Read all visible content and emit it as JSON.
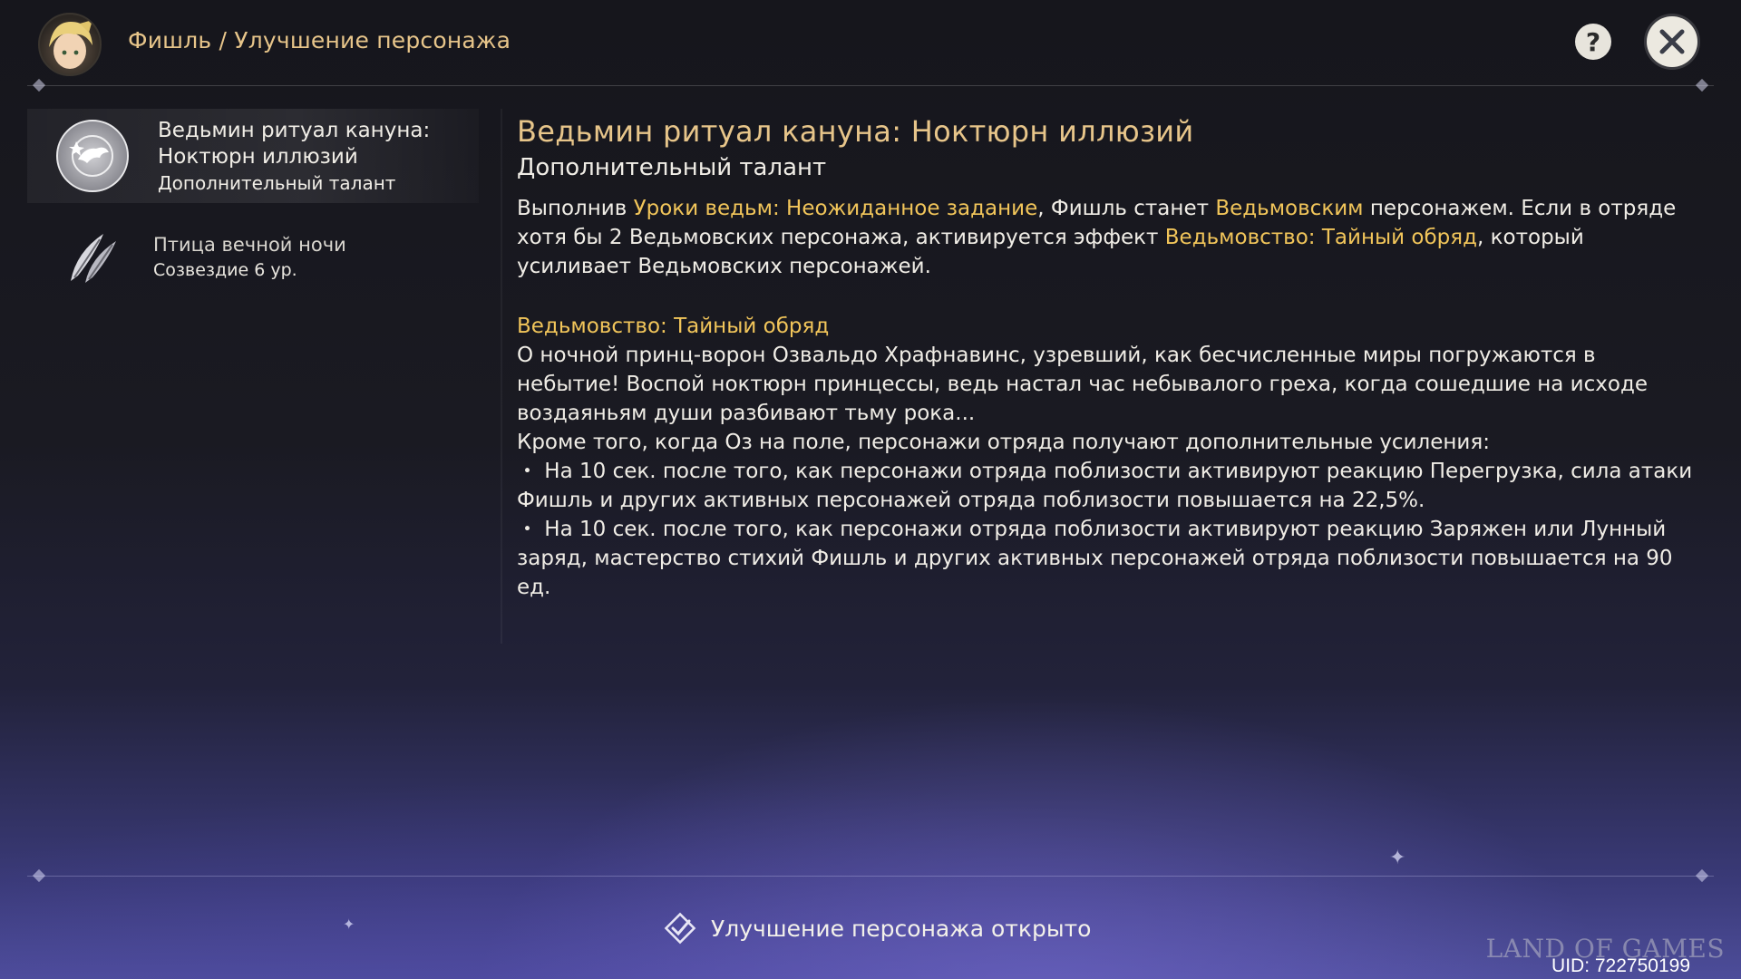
{
  "header": {
    "breadcrumb": "Фишль / Улучшение персонажа"
  },
  "sidebar": {
    "items": [
      {
        "title_line1": "Ведьмин ритуал кануна:",
        "title_line2": "Ноктюрн иллюзий",
        "subtitle": "Дополнительный талант",
        "icon": "crow-emblem-icon",
        "selected": true
      },
      {
        "title_line1": "Птица вечной ночи",
        "subtitle": "Созвездие 6 ур.",
        "icon": "feathers-icon",
        "selected": false
      }
    ]
  },
  "detail": {
    "title": "Ведьмин ритуал кануна: Ноктюрн иллюзий",
    "subtitle": "Дополнительный талант",
    "p1": {
      "t1": "Выполнив ",
      "h1": "Уроки ведьм: Неожиданное задание",
      "t2": ", Фишль станет ",
      "h2": "Ведьмовским",
      "t3": " персонажем. Если в отряде хотя бы 2 Ведьмовских персонажа, активируется эффект ",
      "h3": "Ведьмовство: Тайный обряд",
      "t4": ", который усиливает Ведьмовских персонажей."
    },
    "section_title": "Ведьмовство: Тайный обряд",
    "lore": "О ночной принц-ворон Озвальдо Храфнавинс, узревший, как бесчисленные миры погружаются в небытие! Воспой ноктюрн принцессы, ведь настал час небывалого греха, когда сошедшие на исходе воздаяньям души разбивают тьму рока...",
    "extra": "Кроме того, когда Оз на поле, персонажи отряда получают дополнительные усиления:",
    "bullet1": "・ На 10 сек. после того, как персонажи отряда поблизости активируют реакцию Перегрузка, сила атаки Фишль и других активных персонажей отряда поблизости повышается на 22,5%.",
    "bullet2": "・ На 10 сек. после того, как персонажи отряда поблизости активируют реакцию Заряжен или Лунный заряд, мастерство стихий Фишль и других активных персонажей отряда поблизости повышается на 90 ед."
  },
  "status": {
    "text": "Улучшение персонажа открыто",
    "icon": "check-diamond-icon"
  },
  "watermark": "LAND OF GAMES",
  "uid": "UID: 722750199",
  "colors": {
    "accent_gold": "#e7c58a",
    "highlight": "#f1c55a",
    "text": "#f0ede6"
  }
}
